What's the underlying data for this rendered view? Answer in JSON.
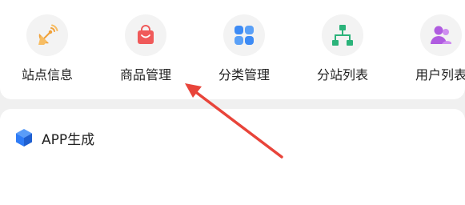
{
  "quick_menu": {
    "items": [
      {
        "label": "站点信息",
        "icon": "satellite-dish-icon"
      },
      {
        "label": "商品管理",
        "icon": "shopping-bag-icon"
      },
      {
        "label": "分类管理",
        "icon": "category-grid-icon"
      },
      {
        "label": "分站列表",
        "icon": "sitemap-icon"
      },
      {
        "label": "用户列表",
        "icon": "users-icon"
      }
    ]
  },
  "app_section": {
    "title": "APP生成",
    "icon": "cube-icon"
  },
  "colors": {
    "satellite": "#f0a13a",
    "bag": "#f05a5a",
    "grid": "#3d8bf5",
    "sitemap": "#2bb37a",
    "users": "#b05ce0",
    "cube": "#2f7cf6",
    "annotation_arrow": "#e8443a"
  }
}
